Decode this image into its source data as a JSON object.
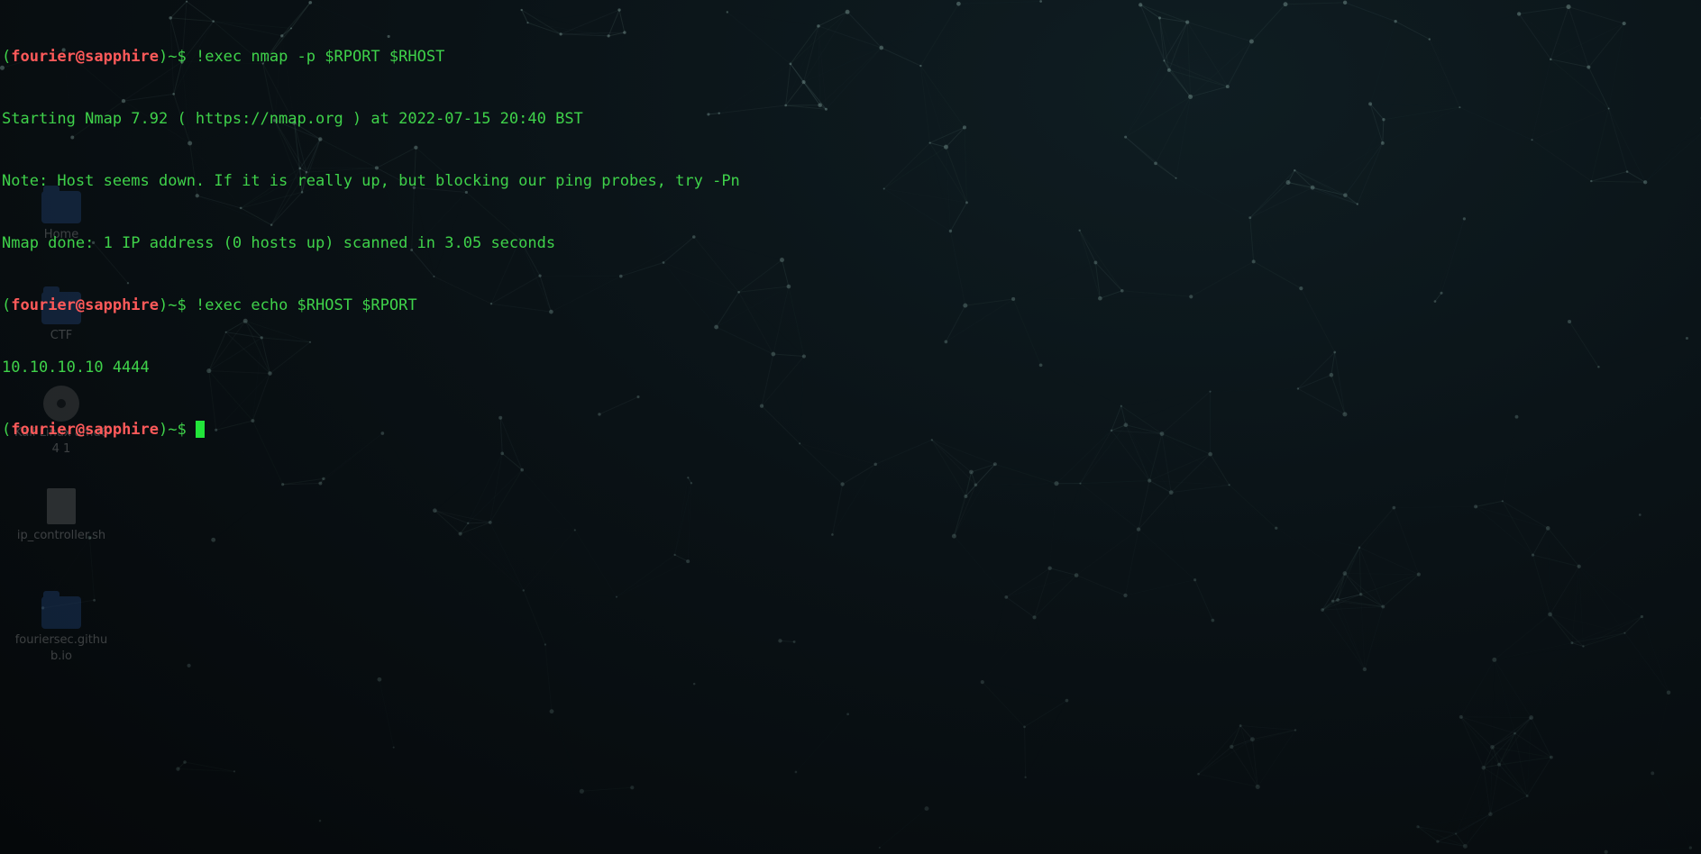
{
  "terminal": {
    "prompt": {
      "open_paren": "(",
      "user_host": "fourier@sapphire",
      "close_paren_path": ")~$ "
    },
    "lines": [
      {
        "type": "prompt",
        "command": "!exec nmap -p $RPORT $RHOST"
      },
      {
        "type": "output",
        "text": "Starting Nmap 7.92 ( https://nmap.org ) at 2022-07-15 20:40 BST"
      },
      {
        "type": "output",
        "text": "Note: Host seems down. If it is really up, but blocking our ping probes, try -Pn"
      },
      {
        "type": "output",
        "text": "Nmap done: 1 IP address (0 hosts up) scanned in 3.05 seconds"
      },
      {
        "type": "prompt",
        "command": "!exec echo $RHOST $RPORT"
      },
      {
        "type": "output",
        "text": "10.10.10.10 4444"
      },
      {
        "type": "prompt",
        "command": ""
      }
    ]
  },
  "desktop": {
    "icons": [
      {
        "name": "home-folder-icon",
        "kind": "folder",
        "label": "Home"
      },
      {
        "name": "ctf-folder-icon",
        "kind": "folder",
        "label": "CTF"
      },
      {
        "name": "disc-icon",
        "kind": "disc",
        "label": "Kali Linux amd64 1"
      },
      {
        "name": "script-file-icon",
        "kind": "file",
        "label": "ip_controller.sh"
      },
      {
        "name": "fouriersec-folder-icon",
        "kind": "folder",
        "label": "fouriersec.github.io"
      }
    ]
  },
  "colors": {
    "prompt_user": "#ff5a5a",
    "terminal_text": "#3fd24a",
    "cursor": "#22e53a",
    "background": "#070b0e"
  }
}
